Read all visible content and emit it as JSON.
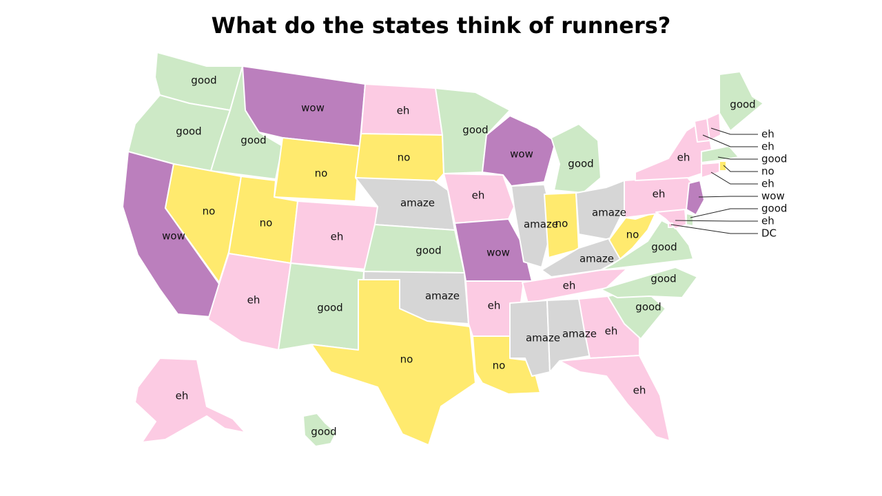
{
  "title": "What do the states think of runners?",
  "colors": {
    "good": "#cde9c6",
    "wow": "#bb7fbd",
    "eh": "#fccbe3",
    "no": "#ffea6e",
    "amaze": "#d6d6d6"
  },
  "states": [
    {
      "id": "WA",
      "value": "good"
    },
    {
      "id": "OR",
      "value": "good"
    },
    {
      "id": "CA",
      "value": "wow"
    },
    {
      "id": "ID",
      "value": "good"
    },
    {
      "id": "NV",
      "value": "no"
    },
    {
      "id": "MT",
      "value": "wow"
    },
    {
      "id": "WY",
      "value": "no"
    },
    {
      "id": "UT",
      "value": "no"
    },
    {
      "id": "AZ",
      "value": "eh"
    },
    {
      "id": "CO",
      "value": "eh"
    },
    {
      "id": "NM",
      "value": "good"
    },
    {
      "id": "ND",
      "value": "eh"
    },
    {
      "id": "SD",
      "value": "no"
    },
    {
      "id": "NE",
      "value": "amaze"
    },
    {
      "id": "KS",
      "value": "good"
    },
    {
      "id": "OK",
      "value": "amaze"
    },
    {
      "id": "TX",
      "value": "no"
    },
    {
      "id": "MN",
      "value": "good"
    },
    {
      "id": "IA",
      "value": "eh"
    },
    {
      "id": "MO",
      "value": "wow"
    },
    {
      "id": "AR",
      "value": "eh"
    },
    {
      "id": "LA",
      "value": "no"
    },
    {
      "id": "WI",
      "value": "wow"
    },
    {
      "id": "IL",
      "value": "amaze"
    },
    {
      "id": "MI",
      "value": "good"
    },
    {
      "id": "IN",
      "value": "no"
    },
    {
      "id": "OH",
      "value": "amaze"
    },
    {
      "id": "KY",
      "value": "amaze"
    },
    {
      "id": "TN",
      "value": "eh"
    },
    {
      "id": "MS",
      "value": "amaze"
    },
    {
      "id": "AL",
      "value": "amaze"
    },
    {
      "id": "GA",
      "value": "eh"
    },
    {
      "id": "FL",
      "value": "eh"
    },
    {
      "id": "SC",
      "value": "good"
    },
    {
      "id": "NC",
      "value": "good"
    },
    {
      "id": "VA",
      "value": "good"
    },
    {
      "id": "WV",
      "value": "no"
    },
    {
      "id": "PA",
      "value": "eh"
    },
    {
      "id": "NY",
      "value": "eh"
    },
    {
      "id": "ME",
      "value": "good"
    },
    {
      "id": "AK",
      "value": "eh"
    },
    {
      "id": "HI",
      "value": "good"
    },
    {
      "id": "NH",
      "value": "eh"
    },
    {
      "id": "VT",
      "value": "eh"
    },
    {
      "id": "MA",
      "value": "good"
    },
    {
      "id": "RI",
      "value": "no"
    },
    {
      "id": "CT",
      "value": "eh"
    },
    {
      "id": "NJ",
      "value": "wow"
    },
    {
      "id": "DE",
      "value": "good"
    },
    {
      "id": "MD",
      "value": "eh"
    },
    {
      "id": "DC",
      "value": "DC"
    }
  ]
}
